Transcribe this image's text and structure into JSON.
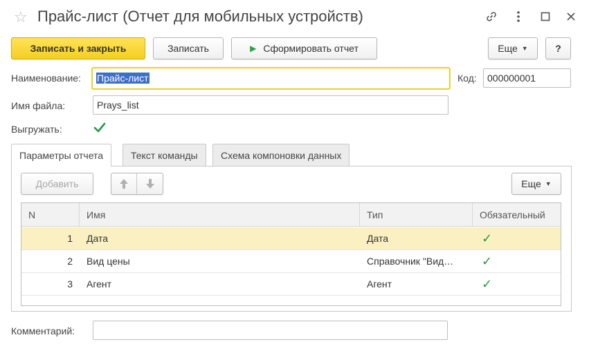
{
  "window": {
    "title": "Прайс-лист (Отчет для мобильных устройств)",
    "icons": [
      "star-icon",
      "link-icon",
      "more-vertical-icon",
      "maximize-icon",
      "close-icon"
    ]
  },
  "toolbar": {
    "save_close_label": "Записать и закрыть",
    "save_label": "Записать",
    "generate_label": "Сформировать отчет",
    "more_label": "Еще",
    "help_label": "?"
  },
  "form": {
    "name_label": "Наименование:",
    "name_value": "Прайс-лист",
    "code_label": "Код:",
    "code_value": "000000001",
    "filename_label": "Имя файла:",
    "filename_value": "Prays_list",
    "export_label": "Выгружать:",
    "export_checked": true,
    "comment_label": "Комментарий:",
    "comment_value": ""
  },
  "tabs": [
    {
      "label": "Параметры отчета",
      "active": true
    },
    {
      "label": "Текст команды",
      "active": false
    },
    {
      "label": "Схема компоновки данных",
      "active": false
    }
  ],
  "params": {
    "add_label": "Добавить",
    "more_label": "Еще",
    "columns": [
      "N",
      "Имя",
      "Тип",
      "Обязательный"
    ],
    "rows": [
      {
        "n": "1",
        "name": "Дата",
        "type": "Дата",
        "required": true,
        "selected": true
      },
      {
        "n": "2",
        "name": "Вид цены",
        "type": "Справочник \"Вид…",
        "required": true,
        "selected": false
      },
      {
        "n": "3",
        "name": "Агент",
        "type": "Агент",
        "required": true,
        "selected": false
      }
    ]
  },
  "colors": {
    "accent_yellow": "#f5cf1f",
    "selected_row": "#fbf0c1",
    "check_green": "#1e9b48",
    "selection_blue": "#3d6fc7"
  }
}
